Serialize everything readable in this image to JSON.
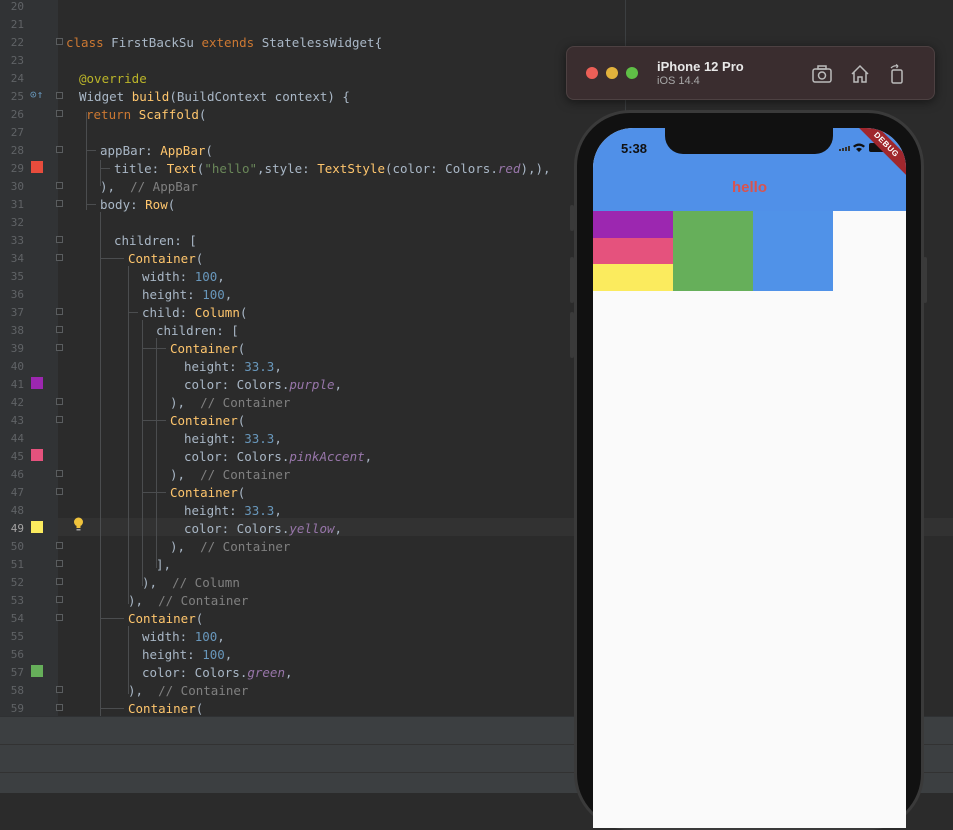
{
  "editor": {
    "line_numbers": [
      "20",
      "21",
      "22",
      "23",
      "24",
      "25",
      "26",
      "27",
      "28",
      "29",
      "30",
      "31",
      "32",
      "33",
      "34",
      "35",
      "36",
      "37",
      "38",
      "39",
      "40",
      "41",
      "42",
      "43",
      "44",
      "45",
      "46",
      "47",
      "48",
      "49",
      "50",
      "51",
      "52",
      "53",
      "54",
      "55",
      "56",
      "57",
      "58",
      "59"
    ],
    "current_line": "49"
  },
  "simulator": {
    "device_name": "iPhone 12 Pro",
    "os_version": "iOS 14.4",
    "buttons": [
      "screenshot-icon",
      "home-icon",
      "rotate-icon"
    ]
  },
  "phone": {
    "time": "5:38",
    "appbar_title": "hello",
    "debug_banner": "DEBUG",
    "colors": {
      "appbar": "#5090e8",
      "purple": "#9c27b0",
      "pink_accent": "#e5527d",
      "yellow": "#fbeb5e",
      "green": "#66af5a",
      "blue": "#5092e8"
    }
  },
  "swatch_colors": {
    "red": "#e74c3c",
    "purple": "#9c27b0",
    "pink": "#e5527d",
    "yellow": "#fbeb5e",
    "green": "#66af5a"
  }
}
